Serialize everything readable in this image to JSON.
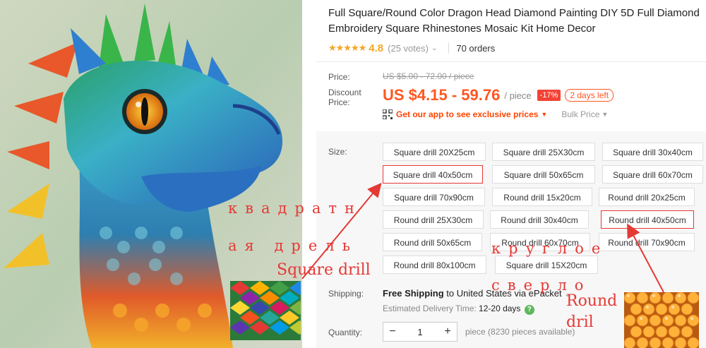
{
  "product": {
    "title": "Full Square/Round Color Dragon Head Diamond Painting DIY 5D Full Diamond Embroidery Square Rhinestones Mosaic Kit Home Decor",
    "stars": "★★★★★",
    "rating": "4.8",
    "votes": "(25 votes)",
    "orders": "70 orders"
  },
  "pricing": {
    "price_label": "Price:",
    "old_price": "US $5.00 - 72.00 / piece",
    "discount_label_1": "Discount",
    "discount_label_2": "Price:",
    "price": "US $4.15 - 59.76",
    "per": "/ piece",
    "discount_badge": "-17%",
    "days_left": "2 days left",
    "app_link": "Get our app to see exclusive prices",
    "bulk": "Bulk Price"
  },
  "size": {
    "label": "Size:",
    "options": [
      "Square drill 20X25cm",
      "Square drill 25X30cm",
      "Square drill 30x40cm",
      "Square drill 40x50cm",
      "Square drill 50x65cm",
      "Square drill 60x70cm",
      "Square drill 70x90cm",
      "Round drill 15x20cm",
      "Round drill 20x25cm",
      "Round drill 25X30cm",
      "Round drill 30x40cm",
      "Round drill 40x50cm",
      "Round drill 50x65cm",
      "Round drill 60x70cm",
      "Round drill 70x90cm",
      "Round drill 80x100cm",
      "Square drill 15X20cm"
    ]
  },
  "shipping": {
    "label": "Shipping:",
    "free": "Free Shipping",
    "to": "to",
    "country": "United States",
    "via": "via ePacket",
    "eta_label": "Estimated Delivery Time:",
    "eta_value": "12-20 days",
    "help": "?"
  },
  "quantity": {
    "label": "Quantity:",
    "minus": "−",
    "value": "1",
    "plus": "+",
    "note": "piece (8230 pieces available)"
  },
  "annotations": {
    "ru_square_1": "квадратн",
    "ru_square_2": "ая дрель",
    "square": "Square drill",
    "ru_round_1": "круглое",
    "ru_round_2": "сверло",
    "round_1": "Round",
    "round_2": "dril"
  },
  "colors": {
    "accent": "#ff5722",
    "highlight": "#e53935"
  }
}
